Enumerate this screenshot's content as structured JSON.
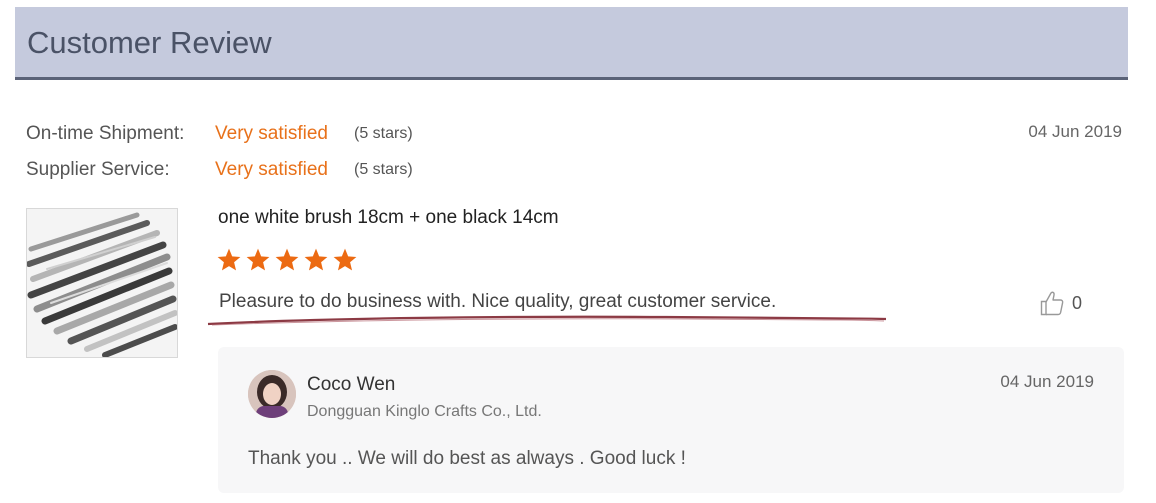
{
  "header": {
    "title": "Customer Review"
  },
  "ratings": {
    "shipment": {
      "label": "On-time Shipment:",
      "value": "Very satisfied",
      "stars": "(5 stars)"
    },
    "service": {
      "label": "Supplier Service:",
      "value": "Very satisfied",
      "stars": "(5 stars)"
    }
  },
  "review": {
    "date": "04 Jun 2019",
    "product_title": "one white brush 18cm + one black 14cm",
    "star_count": 5,
    "text": "Pleasure to do business with. Nice quality, great customer service.",
    "likes": "0",
    "like_icon": "thumbs-up-icon",
    "star_color": "#ec6a12"
  },
  "reply": {
    "name": "Coco Wen",
    "company": "Dongguan Kinglo Crafts Co., Ltd.",
    "date": "04 Jun 2019",
    "text": "Thank you .. We will do best as always . Good luck !"
  },
  "colors": {
    "accent": "#e8711a",
    "header_bg": "#c5cadd",
    "header_border": "#5b6378"
  }
}
